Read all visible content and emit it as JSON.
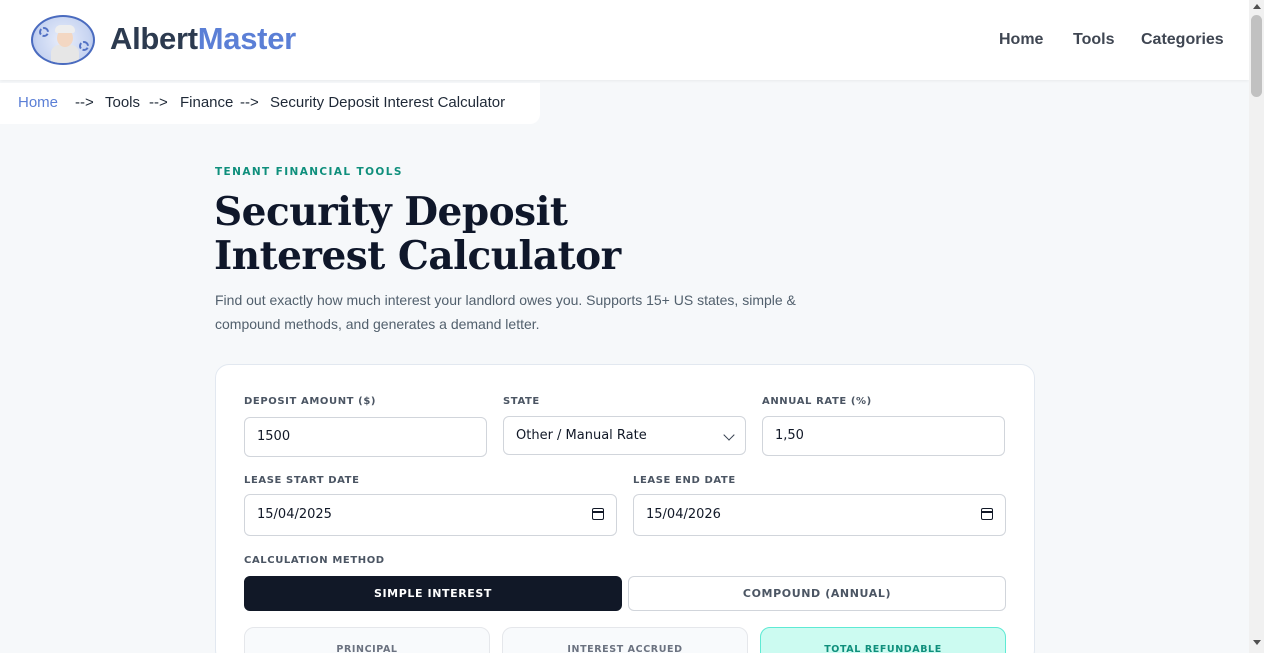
{
  "header": {
    "brand_part1": "Albert",
    "brand_part2": "Master",
    "nav": [
      "Home",
      "Tools",
      "Categories"
    ]
  },
  "breadcrumb": {
    "items": [
      "Home",
      "Tools",
      "Finance",
      "Security Deposit Interest Calculator"
    ],
    "separator": "-->"
  },
  "hero": {
    "eyebrow": "TENANT FINANCIAL TOOLS",
    "title_line1": "Security Deposit",
    "title_line2": "Interest Calculator",
    "subtitle": "Find out exactly how much interest your landlord owes you. Supports 15+ US states, simple & compound methods, and generates a demand letter."
  },
  "form": {
    "deposit_label": "DEPOSIT AMOUNT ($)",
    "deposit_value": "1500",
    "state_label": "STATE",
    "state_value": "Other / Manual Rate",
    "rate_label": "ANNUAL RATE (%)",
    "rate_value": "1,50",
    "start_label": "LEASE START DATE",
    "start_value": "15/04/2025",
    "end_label": "LEASE END DATE",
    "end_value": "15/04/2026",
    "method_label": "CALCULATION METHOD",
    "method_simple": "SIMPLE INTEREST",
    "method_compound": "COMPOUND (ANNUAL)",
    "selected_method": "SIMPLE INTEREST"
  },
  "results": {
    "principal_label": "PRINCIPAL",
    "interest_label": "INTEREST ACCRUED",
    "total_label": "TOTAL REFUNDABLE"
  },
  "colors": {
    "brand_dark": "#2c3a4f",
    "brand_accent": "#5b7fd6",
    "eyebrow_teal": "#0f8f7c",
    "active_button": "#111827",
    "total_bg": "#ccfbf1"
  },
  "icons": {
    "logo": "albert-avatar-logo",
    "select": "chevron-down-icon",
    "date": "calendar-icon"
  }
}
